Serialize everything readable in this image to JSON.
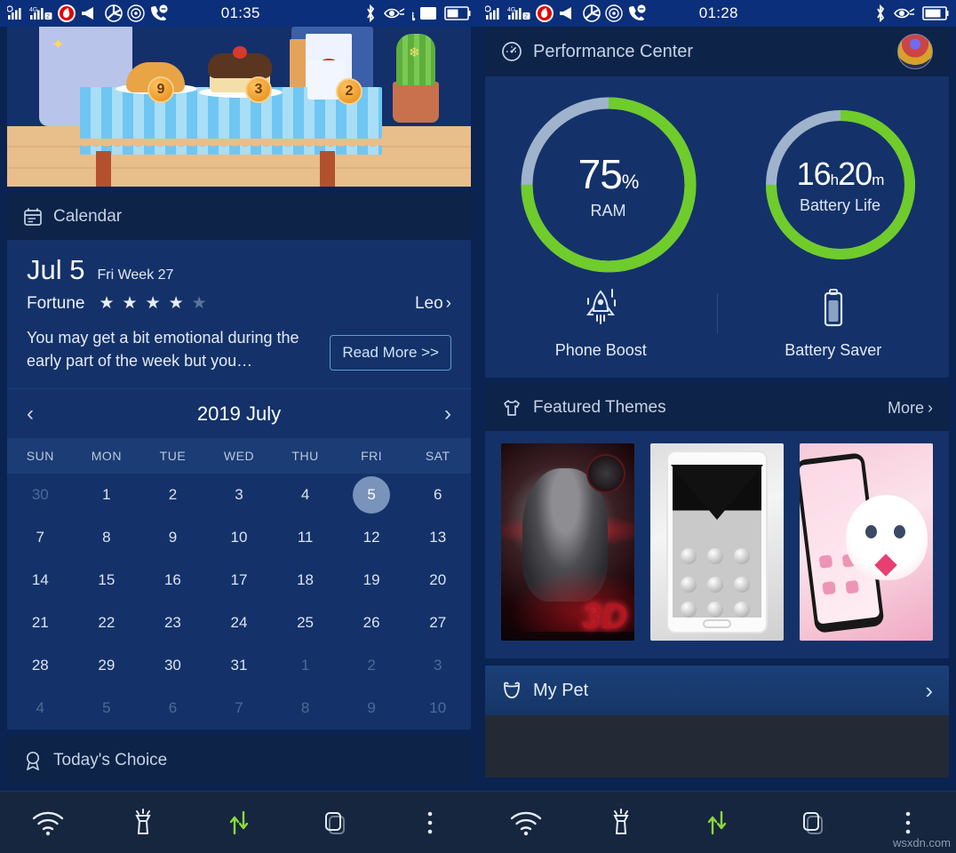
{
  "left_panel": {
    "statusbar": {
      "time": "01:35",
      "left_icons": [
        "signal-bars-sim1-icon",
        "signal-bars-4g-sim2-icon",
        "vodafone-icon",
        "volume-mute-icon",
        "camera-shutter-icon",
        "screen-record-icon",
        "call-icon"
      ],
      "right_icons": [
        "bluetooth-icon",
        "eye-care-icon",
        "cast-icon",
        "battery-icon"
      ]
    },
    "game_banner": {
      "name": "cooking-game-banner",
      "items": [
        {
          "name": "bread",
          "badge": "9"
        },
        {
          "name": "cake",
          "badge": "3"
        },
        {
          "name": "drink",
          "badge": "2"
        }
      ]
    },
    "calendar_card": {
      "header_title": "Calendar",
      "header_icon": "calendar-icon",
      "horoscope": {
        "date": "Jul 5",
        "weekday_week": "Fri Week 27",
        "fortune_label": "Fortune",
        "stars_filled": 4,
        "stars_total": 5,
        "sign": "Leo",
        "sign_chevron": "›",
        "text": "You may get a bit emotional during the early part of the week but you…",
        "read_more": "Read More >>"
      },
      "month_nav": {
        "prev": "‹",
        "title": "2019 July",
        "next": "›"
      },
      "day_headers": [
        "SUN",
        "MON",
        "TUE",
        "WED",
        "THU",
        "FRI",
        "SAT"
      ],
      "weeks": [
        [
          {
            "d": "30",
            "dim": true
          },
          {
            "d": "1"
          },
          {
            "d": "2"
          },
          {
            "d": "3"
          },
          {
            "d": "4"
          },
          {
            "d": "5",
            "today": true
          },
          {
            "d": "6"
          }
        ],
        [
          {
            "d": "7"
          },
          {
            "d": "8"
          },
          {
            "d": "9"
          },
          {
            "d": "10"
          },
          {
            "d": "11"
          },
          {
            "d": "12"
          },
          {
            "d": "13"
          }
        ],
        [
          {
            "d": "14"
          },
          {
            "d": "15"
          },
          {
            "d": "16"
          },
          {
            "d": "17"
          },
          {
            "d": "18"
          },
          {
            "d": "19"
          },
          {
            "d": "20"
          }
        ],
        [
          {
            "d": "21"
          },
          {
            "d": "22"
          },
          {
            "d": "23"
          },
          {
            "d": "24"
          },
          {
            "d": "25"
          },
          {
            "d": "26"
          },
          {
            "d": "27"
          }
        ],
        [
          {
            "d": "28"
          },
          {
            "d": "29"
          },
          {
            "d": "30"
          },
          {
            "d": "31"
          },
          {
            "d": "1",
            "dim": true
          },
          {
            "d": "2",
            "dim": true
          },
          {
            "d": "3",
            "dim": true
          }
        ],
        [
          {
            "d": "4",
            "dim": true
          },
          {
            "d": "5",
            "dim": true
          },
          {
            "d": "6",
            "dim": true
          },
          {
            "d": "7",
            "dim": true
          },
          {
            "d": "8",
            "dim": true
          },
          {
            "d": "9",
            "dim": true
          },
          {
            "d": "10",
            "dim": true
          }
        ]
      ]
    },
    "todays_choice": {
      "title": "Today's Choice",
      "icon": "award-ribbon-icon"
    },
    "navbar_icons": [
      "wifi-icon",
      "flashlight-icon",
      "data-transfer-icon",
      "clone-app-icon",
      "overflow-menu-icon"
    ]
  },
  "right_panel": {
    "statusbar": {
      "time": "01:28",
      "left_icons": [
        "signal-bars-sim1-icon",
        "signal-bars-4g-sim2-icon",
        "vodafone-icon",
        "volume-mute-icon",
        "camera-shutter-icon",
        "screen-record-icon",
        "call-icon"
      ],
      "right_icons": [
        "bluetooth-icon",
        "eye-care-icon",
        "battery-icon"
      ]
    },
    "performance_center": {
      "title": "Performance Center",
      "icon": "speedometer-icon",
      "avatar": "user-avatar",
      "gauges": [
        {
          "name": "ram-gauge",
          "value": "75",
          "unit": "%",
          "label": "RAM",
          "percent": 75,
          "color": "#6fcc2b",
          "track": "#9fb3cc"
        },
        {
          "name": "battery-life-gauge",
          "value_hours": "16",
          "unit_h": "h",
          "value_minutes": "20",
          "unit_m": "m",
          "label": "Battery Life",
          "percent": 75,
          "color": "#6fcc2b",
          "track": "#9fb3cc"
        }
      ],
      "actions": [
        {
          "name": "phone-boost-button",
          "label": "Phone Boost",
          "icon": "rocket-icon"
        },
        {
          "name": "battery-saver-button",
          "label": "Battery Saver",
          "icon": "battery-icon"
        }
      ]
    },
    "featured_themes": {
      "title": "Featured Themes",
      "icon": "tshirt-icon",
      "more_label": "More",
      "more_chevron": "›",
      "thumbnails": [
        {
          "name": "theme-3d-warrior",
          "alt": "3D dark red warrior theme",
          "badge": "3D"
        },
        {
          "name": "theme-silver-diamond-zipper",
          "alt": "Silver diamond zipper lock theme"
        },
        {
          "name": "theme-pink-kitten",
          "alt": "Pink kitten theme"
        }
      ]
    },
    "my_pet": {
      "title": "My Pet",
      "icon": "pet-face-icon",
      "chevron": "›"
    },
    "navbar_icons": [
      "wifi-icon",
      "flashlight-icon",
      "data-transfer-icon",
      "clone-app-icon",
      "overflow-menu-icon"
    ],
    "watermark": "wsxdn.com"
  },
  "colors": {
    "status_bar": "#0b2f7a",
    "card_bg": "#143269",
    "card_head": "#0d2347",
    "accent_green": "#6fcc2b",
    "nav_bg": "#16263e",
    "today_pill": "#7a93bb"
  }
}
